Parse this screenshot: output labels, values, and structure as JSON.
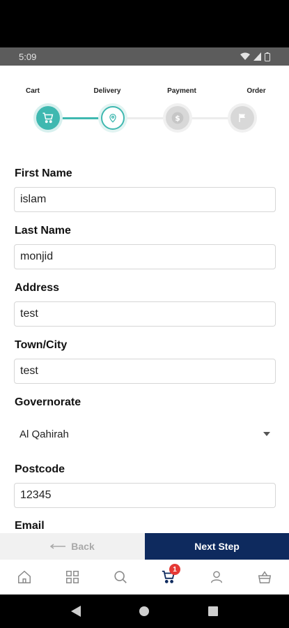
{
  "status": {
    "time": "5:09"
  },
  "stepper": {
    "steps": [
      {
        "label": "Cart",
        "state": "done",
        "icon": "cart-icon"
      },
      {
        "label": "Delivery",
        "state": "current",
        "icon": "location-icon"
      },
      {
        "label": "Payment",
        "state": "pending",
        "icon": "dollar-icon"
      },
      {
        "label": "Order",
        "state": "pending",
        "icon": "flag-icon"
      }
    ]
  },
  "form": {
    "first_name": {
      "label": "First Name",
      "value": "islam"
    },
    "last_name": {
      "label": "Last Name",
      "value": "monjid"
    },
    "address": {
      "label": "Address",
      "value": "test"
    },
    "town": {
      "label": "Town/City",
      "value": "test"
    },
    "governorate": {
      "label": "Governorate",
      "value": "Al Qahirah"
    },
    "postcode": {
      "label": "Postcode",
      "value": "12345"
    },
    "email": {
      "label": "Email"
    }
  },
  "actions": {
    "back_label": "Back",
    "next_label": "Next Step"
  },
  "nav": {
    "items": [
      "home-icon",
      "categories-icon",
      "search-icon",
      "cart-icon",
      "account-icon",
      "basket-icon"
    ],
    "cart_badge": "1",
    "active": "cart"
  },
  "colors": {
    "accent": "#3fb8b0",
    "primary": "#0e2a5e",
    "badge": "#e53935"
  }
}
